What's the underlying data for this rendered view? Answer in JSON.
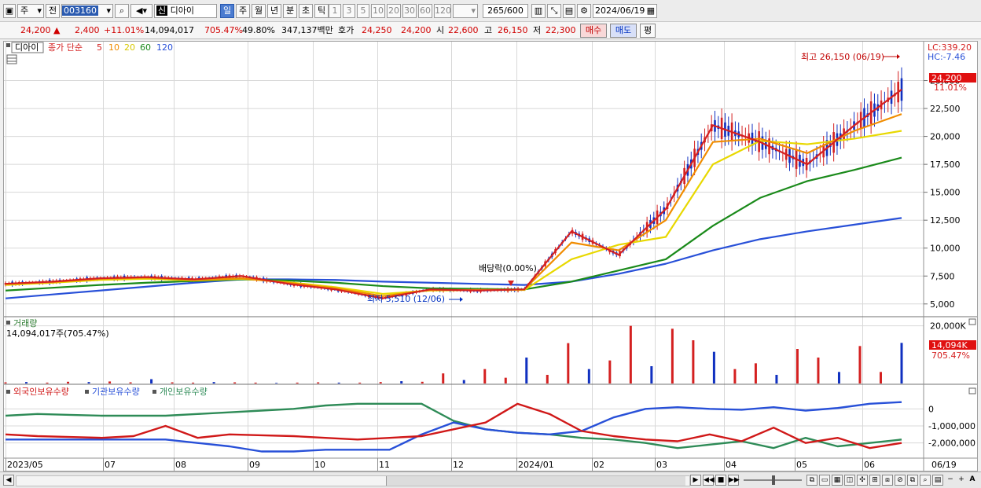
{
  "toolbar": {
    "market": "주",
    "prev": "전",
    "code": "003160",
    "name": "디아이",
    "name_badge": "신",
    "periods": [
      "일",
      "주",
      "월",
      "년",
      "분",
      "초",
      "틱"
    ],
    "active_period": "일",
    "intervals": [
      "1",
      "3",
      "5",
      "10",
      "20",
      "30",
      "60",
      "120"
    ],
    "count": "265",
    "count_total": "/600",
    "date": "2024/06/19"
  },
  "quote": {
    "price": "24,200",
    "change": "2,400",
    "change_pct": "+11.01%",
    "volume": "14,094,017",
    "volume_ratio": "705.47%",
    "turnover": "49.80%",
    "amount": "347,137백만",
    "bid_label": "호가",
    "ask": "24,250",
    "bid": "24,200",
    "open_label": "시",
    "open": "22,600",
    "high_label": "고",
    "high": "26,150",
    "low_label": "저",
    "low": "22,300",
    "buy_label": "매수",
    "sell_label": "매도",
    "eval_label": "평"
  },
  "price_panel": {
    "name_tag": "디아이",
    "legend_title": "종가 단순",
    "ma_legend": [
      {
        "label": "5",
        "color": "#d42020"
      },
      {
        "label": "10",
        "color": "#f08c00"
      },
      {
        "label": "20",
        "color": "#e8d800"
      },
      {
        "label": "60",
        "color": "#1a8a1a"
      },
      {
        "label": "120",
        "color": "#2850d8"
      }
    ],
    "lc_label": "LC:339.20",
    "hc_label": "HC:-7.46",
    "current_price_tag": "24,200",
    "current_pct_tag": "11.01%",
    "high_annotation": "최고 26,150 (06/19)",
    "low_annotation": "최저 5,510 (12/06)",
    "dividend_annotation": "배당락(0.00%)"
  },
  "volume_panel": {
    "title": "거래량",
    "value": "14,094,017주(705.47%)",
    "current_tag": "14,094K",
    "pct_tag": "705.47%"
  },
  "holding_panel": {
    "legends": [
      {
        "label": "외국인보유수량",
        "color": "#d01818"
      },
      {
        "label": "기관보유수량",
        "color": "#2850d8"
      },
      {
        "label": "개인보유수량",
        "color": "#2e8b57"
      }
    ]
  },
  "x_axis_labels": [
    "2023/05",
    "07",
    "08",
    "09",
    "10",
    "11",
    "12",
    "2024/01",
    "02",
    "03",
    "04",
    "05",
    "06",
    "06/19"
  ],
  "colors": {
    "up": "#d42020",
    "down": "#1030c0",
    "grid": "#d8d8d8"
  },
  "chart_data": [
    {
      "type": "line",
      "title": "",
      "y_ticks": [
        "25,000",
        "22,500",
        "20,000",
        "17,500",
        "15,000",
        "12,500",
        "10,000",
        "7,500",
        "5,000"
      ],
      "ylim": [
        4000,
        27500
      ],
      "x": [
        "2023/05",
        "2023/06",
        "2023/07",
        "2023/08",
        "2023/09",
        "2023/09/20",
        "2023/10",
        "2023/11",
        "2023/12/06",
        "2024/01",
        "2024/02",
        "2024/02/26",
        "2024/03",
        "2024/03/20",
        "2024/04",
        "2024/04/15",
        "2024/05",
        "2024/05/15",
        "2024/06",
        "2024/06/19"
      ],
      "series": [
        {
          "name": "5",
          "values": [
            6800,
            7000,
            7300,
            7400,
            7200,
            7500,
            6800,
            6300,
            5510,
            6300,
            6200,
            6300,
            11500,
            9400,
            13500,
            21000,
            19500,
            17500,
            21000,
            24200
          ]
        },
        {
          "name": "10",
          "values": [
            6800,
            6950,
            7250,
            7350,
            7150,
            7300,
            6900,
            6400,
            5700,
            6250,
            6250,
            6300,
            10500,
            9800,
            12500,
            19500,
            19800,
            18500,
            20500,
            22000
          ]
        },
        {
          "name": "20",
          "values": [
            6700,
            6900,
            7150,
            7250,
            7100,
            7250,
            6950,
            6500,
            5900,
            6200,
            6250,
            6250,
            9000,
            10300,
            11000,
            17500,
            19600,
            19300,
            19800,
            20500
          ]
        },
        {
          "name": "60",
          "values": [
            6200,
            6450,
            6700,
            6900,
            7050,
            7200,
            7100,
            6900,
            6600,
            6400,
            6350,
            6300,
            7000,
            8000,
            9000,
            12000,
            14500,
            16000,
            17000,
            18100
          ]
        },
        {
          "name": "120",
          "values": [
            5500,
            5850,
            6200,
            6550,
            6900,
            7200,
            7200,
            7150,
            7000,
            6900,
            6800,
            6700,
            7000,
            7700,
            8600,
            9800,
            10800,
            11500,
            12100,
            12700
          ]
        }
      ]
    },
    {
      "type": "bar",
      "title": "",
      "y_ticks": [
        "20,000K"
      ],
      "ylim": [
        0,
        21000
      ],
      "unit": "K",
      "values": [
        400,
        500,
        300,
        600,
        500,
        700,
        400,
        1500,
        400,
        300,
        500,
        400,
        300,
        200,
        300,
        400,
        300,
        300,
        500,
        800,
        600,
        3500,
        1200,
        5000,
        2000,
        9000,
        3000,
        14000,
        5000,
        8000,
        20000,
        6000,
        19000,
        15000,
        11000,
        5000,
        7000,
        3000,
        12000,
        9000,
        4000,
        13000,
        4000,
        14094
      ]
    },
    {
      "type": "line",
      "title": "",
      "y_ticks": [
        "0",
        "-1,000,000",
        "-2,000,000"
      ],
      "ylim": [
        -2800000,
        800000
      ],
      "series": [
        {
          "name": "외국인보유수량",
          "values": [
            -1500000,
            -1600000,
            -1650000,
            -1700000,
            -1600000,
            -1000000,
            -1700000,
            -1500000,
            -1550000,
            -1600000,
            -1700000,
            -1800000,
            -1700000,
            -1600000,
            -1200000,
            -800000,
            300000,
            -300000,
            -1300000,
            -1600000,
            -1800000,
            -1900000,
            -1500000,
            -1900000,
            -1100000,
            -2000000,
            -1700000,
            -2300000,
            -2000000
          ]
        },
        {
          "name": "기관보유수량",
          "values": [
            -1800000,
            -1800000,
            -1800000,
            -1800000,
            -1800000,
            -1800000,
            -2000000,
            -2200000,
            -2500000,
            -2500000,
            -2400000,
            -2400000,
            -2400000,
            -1500000,
            -800000,
            -1200000,
            -1400000,
            -1500000,
            -1300000,
            -500000,
            0,
            100000,
            0,
            -50000,
            100000,
            -100000,
            50000,
            300000,
            400000
          ]
        },
        {
          "name": "개인보유수량",
          "values": [
            -400000,
            -300000,
            -350000,
            -400000,
            -400000,
            -400000,
            -300000,
            -200000,
            -100000,
            0,
            200000,
            300000,
            300000,
            300000,
            -700000,
            -1200000,
            -1400000,
            -1500000,
            -1700000,
            -1800000,
            -2000000,
            -2300000,
            -2100000,
            -1900000,
            -2300000,
            -1700000,
            -2200000,
            -2000000,
            -1800000
          ]
        }
      ]
    }
  ]
}
